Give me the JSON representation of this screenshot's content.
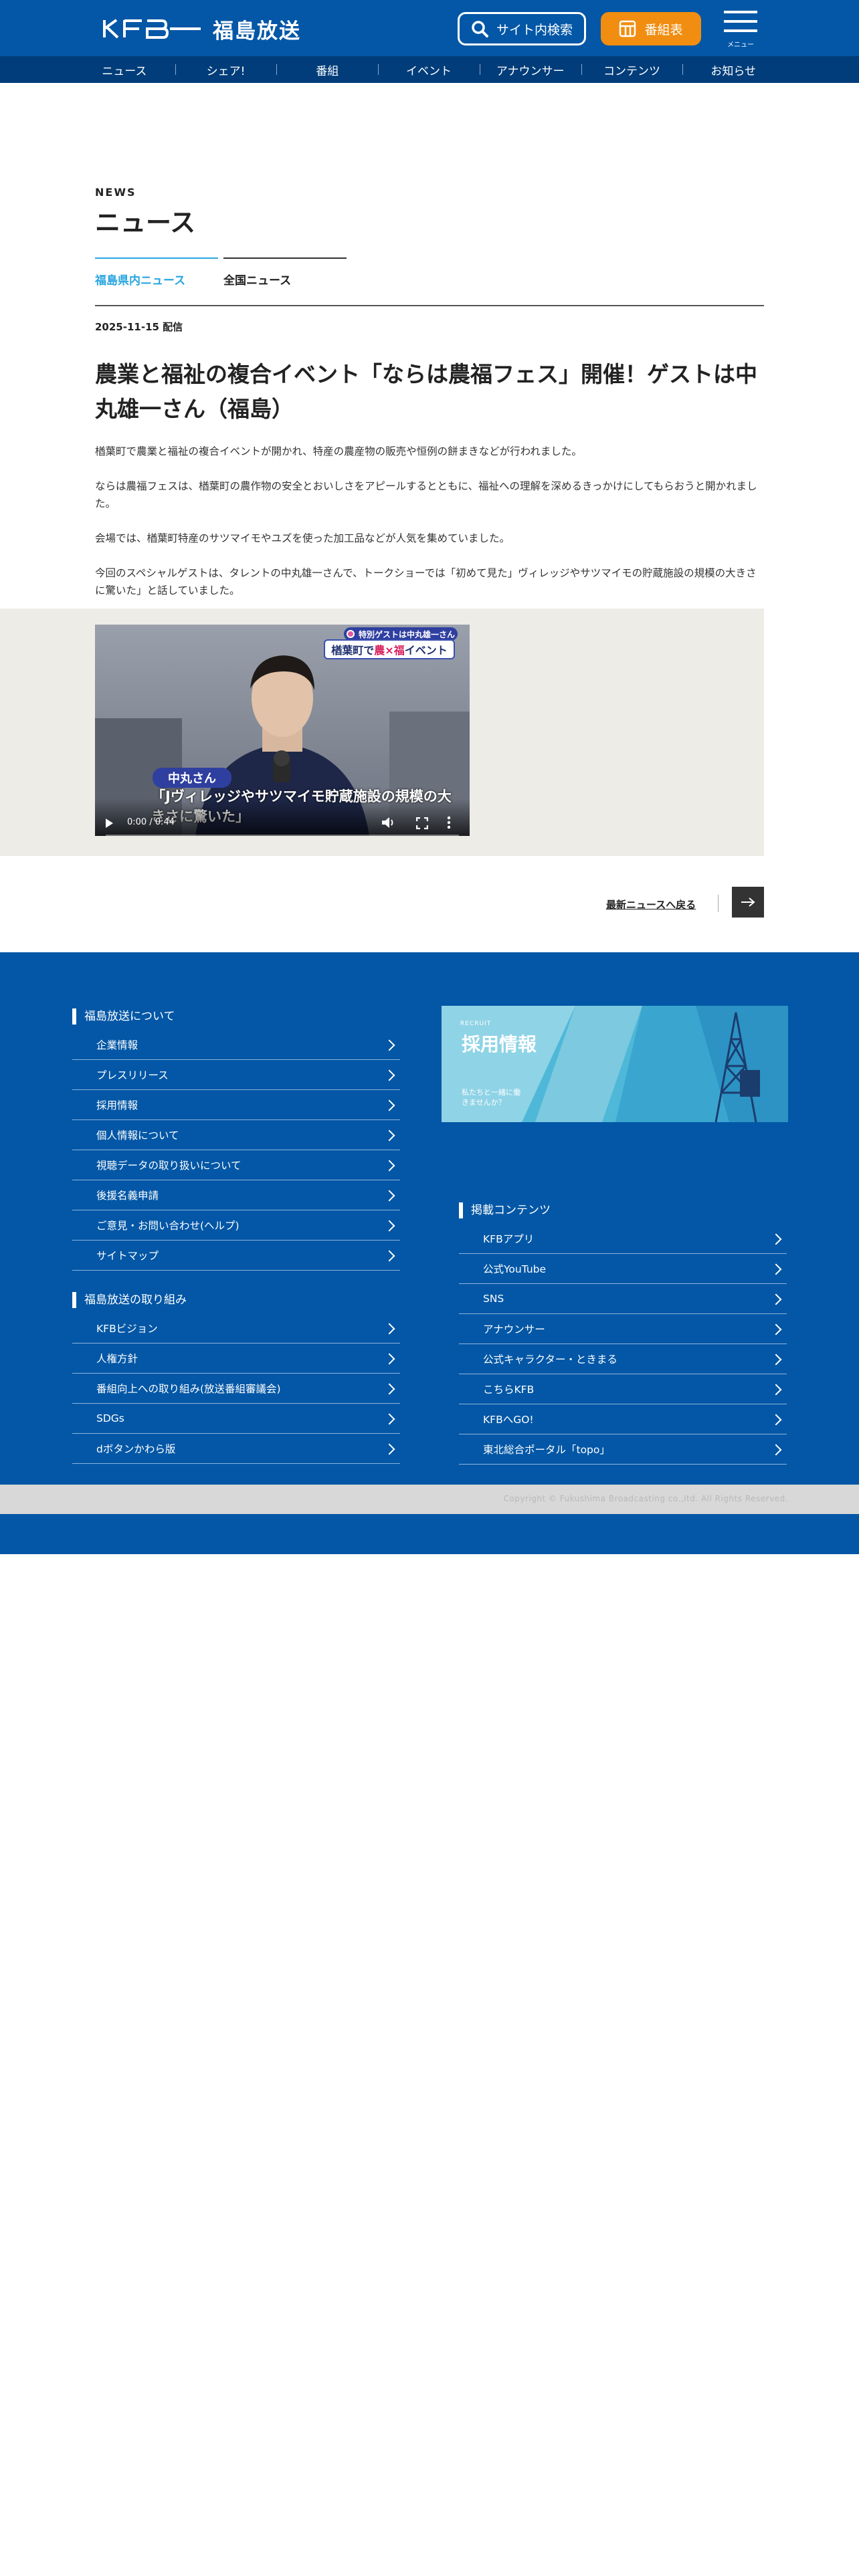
{
  "header": {
    "logo_name": "福島放送",
    "search_label": "サイト内検索",
    "program_label": "番組表",
    "menu_label": "メニュー"
  },
  "nav": {
    "items": [
      "ニュース",
      "シェア!",
      "番組",
      "イベント",
      "アナウンサー",
      "コンテンツ",
      "お知らせ"
    ]
  },
  "main": {
    "eyebrow": "NEWS",
    "title": "ニュース",
    "tabs": [
      "福島県内ニュース",
      "全国ニュース"
    ],
    "active_tab": "福島県内ニュース",
    "pubdate": "2025-11-15 配信",
    "headline": "農業と福祉の複合イベント「ならは農福フェス」開催！ゲストは中丸雄一さん（福島）",
    "paragraphs": [
      "楢葉町で農業と福祉の複合イベントが開かれ、特産の農産物の販売や恒例の餅まきなどが行われました。",
      "ならは農福フェスは、楢葉町の農作物の安全とおいしさをアピールするとともに、福祉への理解を深めるきっかけにしてもらおうと開かれました。",
      "会場では、楢葉町特産のサツマイモやユズを使った加工品などが人気を集めていました。",
      "今回のスペシャルゲストは、タレントの中丸雄一さんで、トークショーでは「初めて見た」ヴィレッジやサツマイモの貯蔵施設の規模の大きさに驚いた」と話していました。"
    ]
  },
  "video": {
    "guest_banner": "特別ゲストは中丸雄一さん",
    "event_banner_pre": "楢葉町で",
    "event_banner_hl": "農×福",
    "event_banner_post": "イベント",
    "speaker_tag": "中丸さん",
    "caption": "「Jヴィレッジやサツマイモ貯蔵施設の規模の大きさに驚いた」",
    "time": "0:00 / 0:44",
    "progress": 0
  },
  "back_link": "最新ニュースへ戻る",
  "footer": {
    "about_heading": "福島放送について",
    "about_items": [
      "企業情報",
      "プレスリリース",
      "採用情報",
      "個人情報について",
      "視聴データの取り扱いについて",
      "後援名義申請",
      "ご意見・お問い合わせ(ヘルプ)",
      "サイトマップ"
    ],
    "effort_heading": "福島放送の取り組み",
    "effort_items": [
      "KFBビジョン",
      "人権方針",
      "番組向上への取り組み(放送番組審議会)",
      "SDGs",
      "dボタンかわら版"
    ],
    "content_heading": "掲載コンテンツ",
    "content_items": [
      "KFBアプリ",
      "公式YouTube",
      "SNS",
      "アナウンサー",
      "公式キャラクター・ときまる",
      "こちらKFB",
      "KFBへGO!",
      "東北総合ポータル「topo」"
    ],
    "recruit_sub": "RECRUIT",
    "recruit_title": "採用情報",
    "recruit_text": "私たちと一緒に働きませんか？",
    "copyright": "Copyright © Fukushima Broadcasting co.,ltd. All Rights Reserved."
  },
  "colors": {
    "brand_blue": "#0357a6",
    "nav_blue": "#003d7a",
    "accent_orange": "#f18d11",
    "active_tab": "#2aa6e0"
  }
}
